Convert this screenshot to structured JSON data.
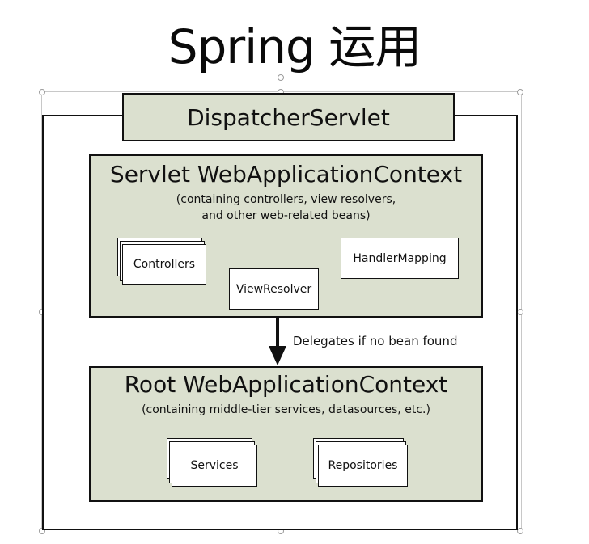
{
  "slide": {
    "title": "Spring 运用"
  },
  "diagram": {
    "dispatcher": {
      "label": "DispatcherServlet"
    },
    "servlet_context": {
      "title": "Servlet WebApplicationContext",
      "subtitle_line1": "(containing controllers, view resolvers,",
      "subtitle_line2": "and other web-related beans)",
      "components": {
        "controllers": "Controllers",
        "view_resolver": "ViewResolver",
        "handler_mapping": "HandlerMapping"
      }
    },
    "arrow": {
      "label": "Delegates if no bean found"
    },
    "root_context": {
      "title": "Root WebApplicationContext",
      "subtitle": "(containing middle-tier services, datasources, etc.)",
      "components": {
        "services": "Services",
        "repositories": "Repositories"
      }
    }
  }
}
